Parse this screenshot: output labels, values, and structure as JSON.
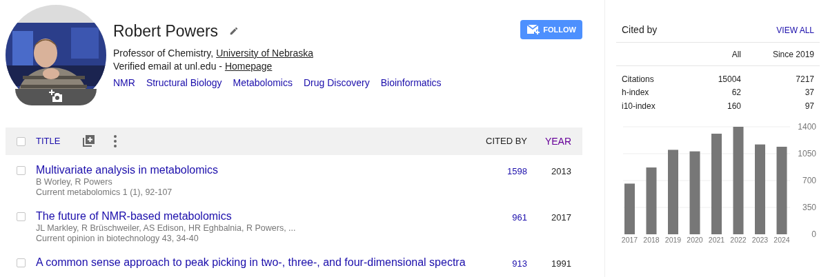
{
  "profile": {
    "name": "Robert Powers",
    "affiliation": "Professor of Chemistry, ",
    "affiliation_link": "University of Nebraska",
    "email": "Verified email at unl.edu - ",
    "homepage": "Homepage",
    "interests": [
      "NMR",
      "Structural Biology",
      "Metabolomics",
      "Drug Discovery",
      "Bioinformatics"
    ]
  },
  "follow_button": "FOLLOW",
  "articles": {
    "header": {
      "checked": false,
      "title": "TITLE",
      "cited_by": "CITED BY",
      "year": "YEAR"
    },
    "rows": [
      {
        "checked": false,
        "title": "Multivariate analysis in metabolomics",
        "authors": "B Worley, R Powers",
        "venue": "Current metabolomics 1 (1), 92-107",
        "cited_by": "1598",
        "year": "2013"
      },
      {
        "checked": false,
        "title": "The future of NMR-based metabolomics",
        "authors": "JL Markley, R Brüschweiler, AS Edison, HR Eghbalnia, R Powers, ...",
        "venue": "Current opinion in biotechnology 43, 34-40",
        "cited_by": "961",
        "year": "2017"
      },
      {
        "checked": false,
        "title": "A common sense approach to peak picking in two-, three-, and four-dimensional spectra",
        "cited_by": "913",
        "year": "1991"
      }
    ]
  },
  "cited_by": {
    "title": "Cited by",
    "view_all": "VIEW ALL",
    "columns": [
      "All",
      "Since 2019"
    ],
    "rows": [
      {
        "label": "Citations",
        "all": "15004",
        "since": "7217"
      },
      {
        "label": "h-index",
        "all": "62",
        "since": "37"
      },
      {
        "label": "i10-index",
        "all": "160",
        "since": "97"
      }
    ],
    "chart_data": {
      "type": "bar",
      "categories": [
        "2017",
        "2018",
        "2019",
        "2020",
        "2021",
        "2022",
        "2023",
        "2024"
      ],
      "values": [
        660,
        870,
        1100,
        1080,
        1310,
        1400,
        1170,
        1140
      ],
      "grid": true,
      "ylim": [
        0,
        1400
      ],
      "yticks": [
        0,
        350,
        700,
        1050,
        1400
      ]
    }
  }
}
